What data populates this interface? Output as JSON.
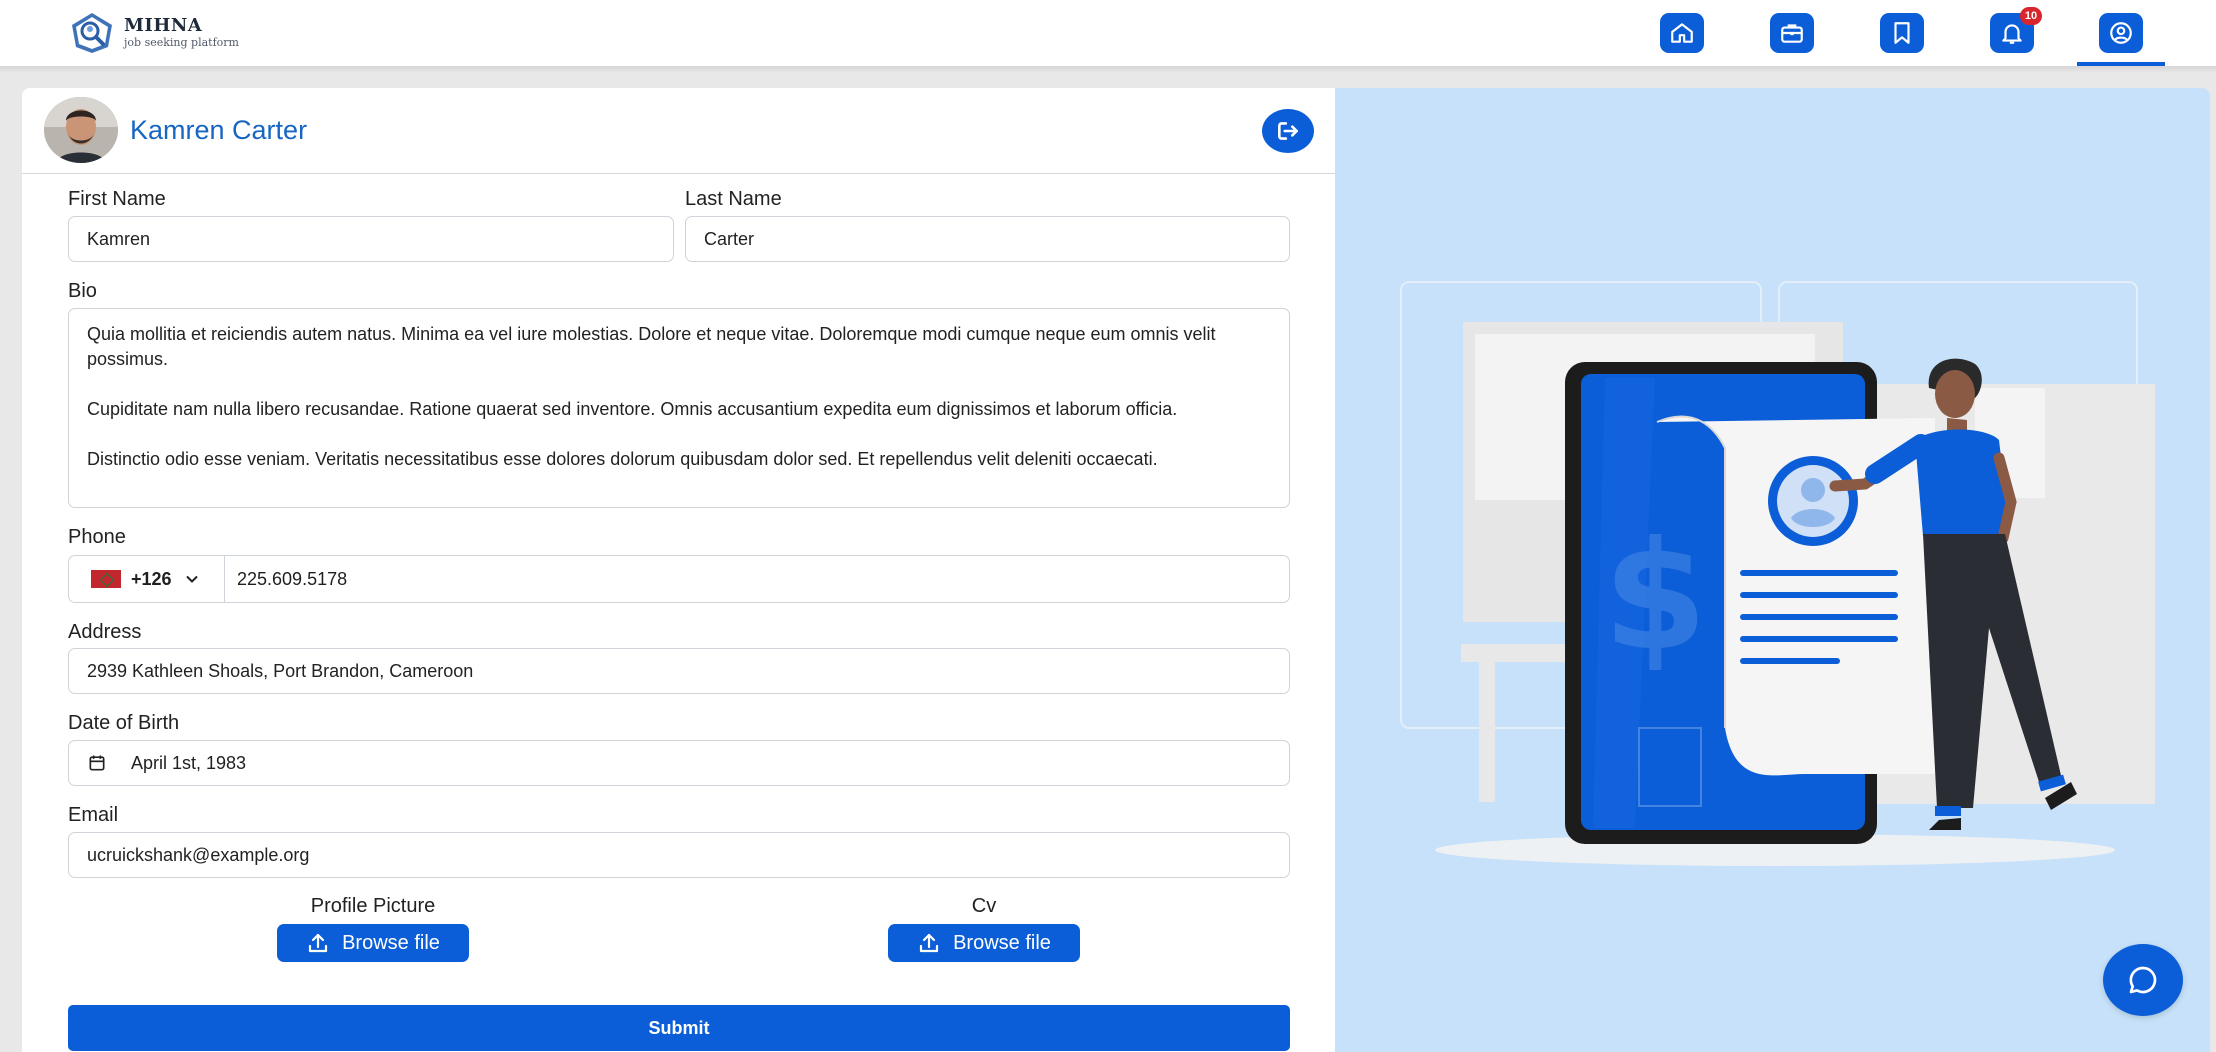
{
  "brand": {
    "name": "MIHNA",
    "tagline": "job seeking platform"
  },
  "nav": {
    "items": [
      {
        "name": "home",
        "icon": "home-icon"
      },
      {
        "name": "jobs",
        "icon": "briefcase-icon"
      },
      {
        "name": "saved",
        "icon": "bookmark-icon"
      },
      {
        "name": "notifications",
        "icon": "bell-icon",
        "badge": "10"
      },
      {
        "name": "profile",
        "icon": "user-circle-icon",
        "active": true
      }
    ]
  },
  "profile": {
    "name": "Kamren Carter"
  },
  "form": {
    "first_name_label": "First Name",
    "first_name_value": "Kamren",
    "last_name_label": "Last Name",
    "last_name_value": "Carter",
    "bio_label": "Bio",
    "bio_paragraphs": [
      "Quia mollitia et reiciendis autem natus. Minima ea vel iure molestias. Dolore et neque vitae. Doloremque modi cumque neque eum omnis velit possimus.",
      "Cupiditate nam nulla libero recusandae. Ratione quaerat sed inventore. Omnis accusantium expedita eum dignissimos et laborum officia.",
      "Distinctio odio esse veniam. Veritatis necessitatibus esse dolores dolorum quibusdam dolor sed. Et repellendus velit deleniti occaecati."
    ],
    "phone_label": "Phone",
    "phone_code": "+126",
    "phone_value": "225.609.5178",
    "address_label": "Address",
    "address_value": "2939 Kathleen Shoals, Port Brandon, Cameroon",
    "dob_label": "Date of Birth",
    "dob_value": "April 1st, 1983",
    "email_label": "Email",
    "email_value": "ucruickshank@example.org",
    "profile_picture_label": "Profile Picture",
    "cv_label": "Cv",
    "browse_label": "Browse file",
    "submit_label": "Submit"
  },
  "colors": {
    "primary": "#0b5ed7",
    "illustration_bg": "#c6e1f9",
    "name_text": "#1766c2",
    "badge": "#d9262c"
  }
}
